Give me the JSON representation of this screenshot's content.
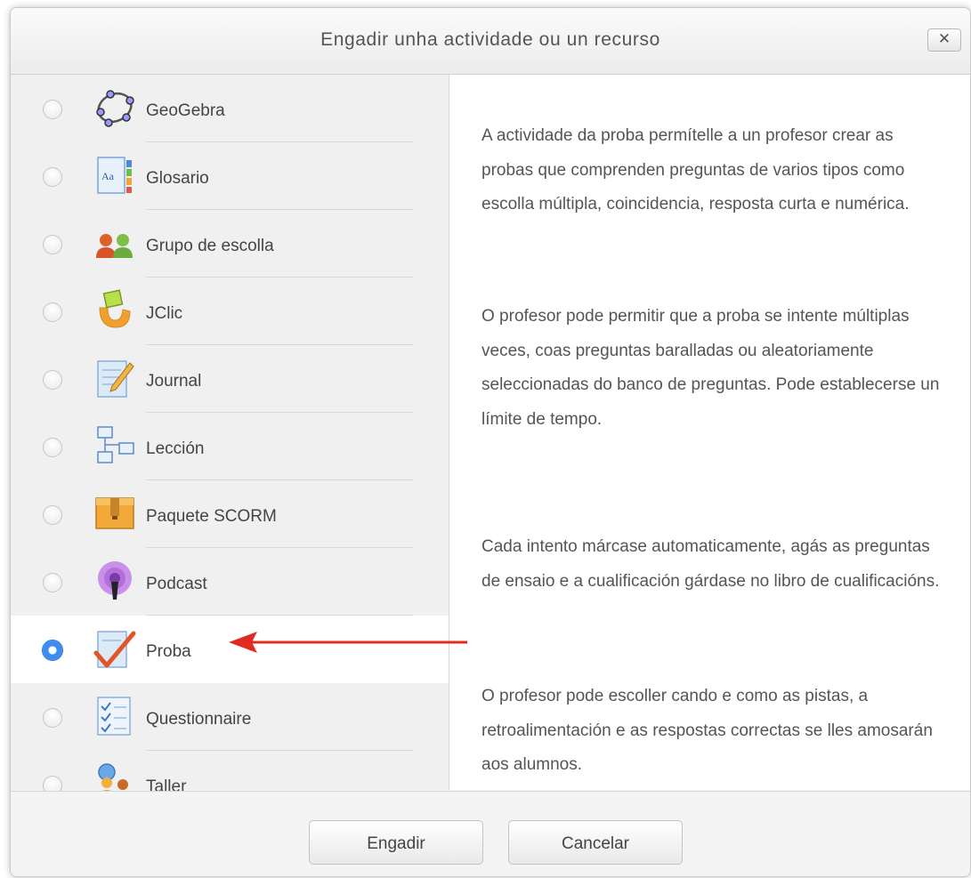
{
  "dialog": {
    "title": "Engadir unha actividade ou un recurso",
    "close_label": "✕"
  },
  "options": [
    {
      "label": "GeoGebra",
      "icon": "geogebra-icon",
      "selected": false
    },
    {
      "label": "Glosario",
      "icon": "glossary-icon",
      "selected": false
    },
    {
      "label": "Grupo de escolla",
      "icon": "group-choice-icon",
      "selected": false
    },
    {
      "label": "JClic",
      "icon": "jclic-icon",
      "selected": false
    },
    {
      "label": "Journal",
      "icon": "journal-icon",
      "selected": false
    },
    {
      "label": "Lección",
      "icon": "lesson-icon",
      "selected": false
    },
    {
      "label": "Paquete SCORM",
      "icon": "scorm-package-icon",
      "selected": false
    },
    {
      "label": "Podcast",
      "icon": "podcast-icon",
      "selected": false
    },
    {
      "label": "Proba",
      "icon": "quiz-icon",
      "selected": true
    },
    {
      "label": "Questionnaire",
      "icon": "questionnaire-icon",
      "selected": false
    },
    {
      "label": "Taller",
      "icon": "workshop-icon",
      "selected": false
    }
  ],
  "description": {
    "paragraphs": [
      "A actividade da proba permítelle a un profesor crear as probas que comprenden preguntas de varios tipos como escolla múltipla, coincidencia, resposta curta e numérica.",
      "O profesor pode permitir que a proba se intente múltiplas veces, coas preguntas baralladas ou aleatoriamente seleccionadas do banco de preguntas. Pode establecerse un límite de tempo.",
      "Cada intento márcase automaticamente, agás as preguntas de ensaio e a cualificación gárdase no libro de cualificacións.",
      "O profesor pode escoller cando e como as pistas, a retroalimentación e as respostas correctas se lles amosarán aos alumnos."
    ]
  },
  "footer": {
    "add_label": "Engadir",
    "cancel_label": "Cancelar"
  },
  "colors": {
    "selected_radio": "#3d8cf0",
    "annotation_arrow": "#e02b20"
  }
}
